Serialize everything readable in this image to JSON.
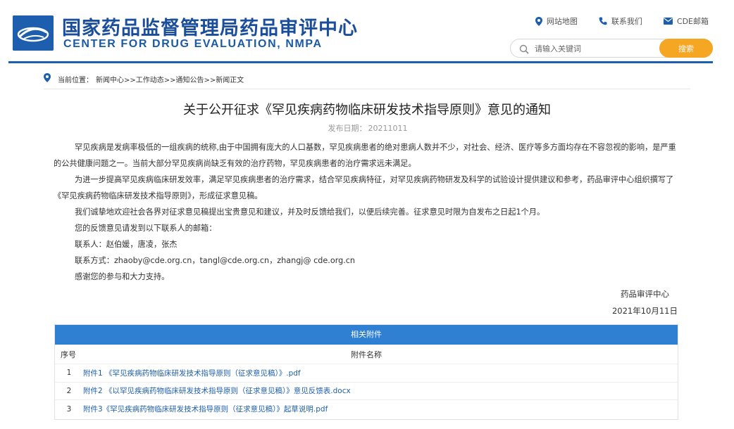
{
  "header": {
    "title_cn": "国家药品监督管理局药品审评中心",
    "title_en": "CENTER FOR DRUG EVALUATION, NMPA",
    "links": {
      "sitemap": "网站地图",
      "contact": "联系我们",
      "mail": "CDE邮箱"
    },
    "search": {
      "placeholder": "请输入关键词",
      "button": "搜索"
    },
    "accent_color": "#1d5fae",
    "search_button_color": "#f5a623"
  },
  "breadcrumb": {
    "label": "当前位置：",
    "path": "新闻中心>>工作动态>>通知公告>>新闻正文"
  },
  "article": {
    "title": "关于公开征求《罕见疾病药物临床研发技术指导原则》意见的通知",
    "date_label": "发布日期：",
    "date": "20211011",
    "paragraphs": [
      "罕见疾病是发病率极低的一组疾病的统称,由于中国拥有庞大的人口基数，罕见疾病患者的绝对患病人数并不少，对社会、经济、医疗等多方面均存在不容忽视的影响，是严重的公共健康问题之一。当前大部分罕见疾病尚缺乏有效的治疗药物，罕见疾病患者的治疗需求远未满足。",
      "为进一步提高罕见疾病临床研发效率，满足罕见疾病患者的治疗需求，结合罕见疾病特征，对罕见疾病药物研发及科学的试验设计提供建议和参考，药品审评中心组织撰写了《罕见疾病药物临床研发技术指导原则》，形成征求意见稿。",
      "我们诚挚地欢迎社会各界对征求意见稿提出宝贵意见和建议，并及时反馈给我们，以便后续完善。征求意见时限为自发布之日起1个月。",
      "您的反馈意见请发到以下联系人的邮箱：",
      "联系人：赵伯媛，唐凌，张杰",
      "联系方式：zhaoby@cde.org.cn，tangl@cde.org.cn，zhangj@ cde.org.cn",
      "感谢您的参与和大力支持。"
    ],
    "signature": "药品审评中心",
    "signature_date": "2021年10月11日"
  },
  "attachments": {
    "heading": "相关附件",
    "col_no": "序号",
    "col_name": "附件名称",
    "items": [
      {
        "no": "1",
        "name": "附件1 《罕见疾病药物临床研发技术指导原则（征求意见稿）》.pdf"
      },
      {
        "no": "2",
        "name": "附件2 《以罕见疾病药物临床研发技术指导原则（征求意见稿）》意见反馈表.docx"
      },
      {
        "no": "3",
        "name": "附件3《罕见疾病药物临床研发技术指导原则（征求意见稿）》起草说明.pdf"
      }
    ]
  }
}
